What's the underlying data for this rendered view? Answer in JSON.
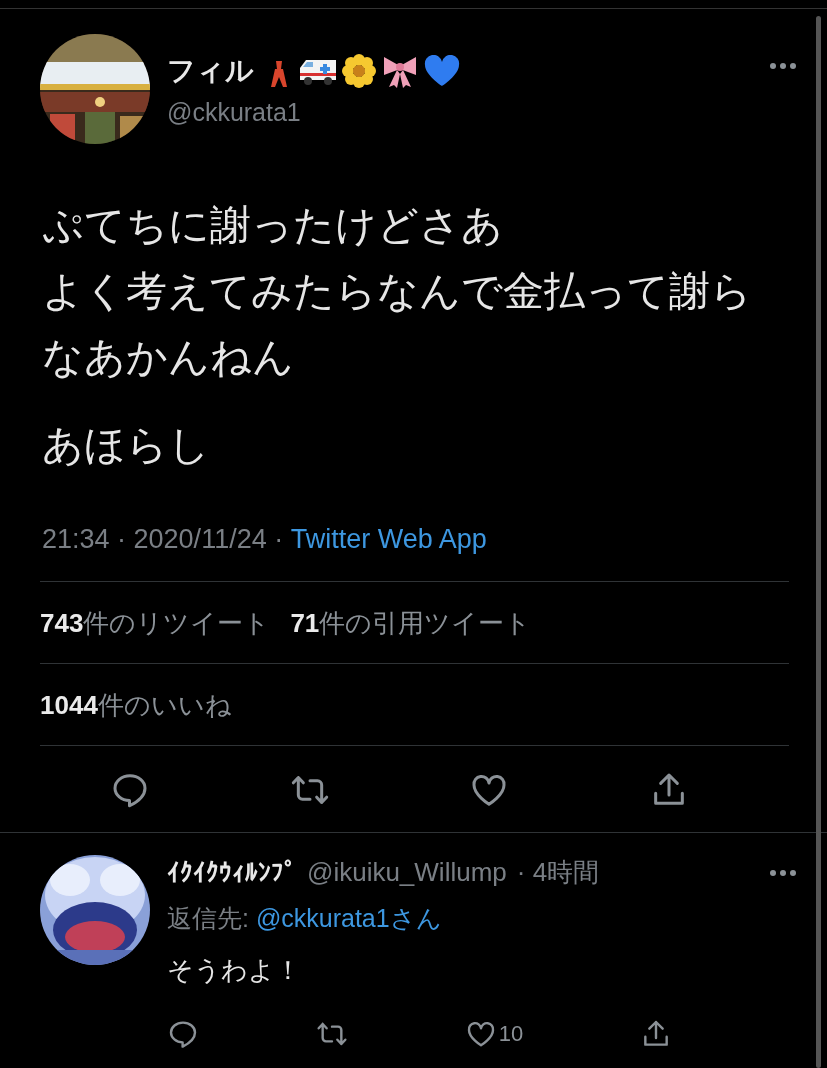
{
  "tweet": {
    "author": {
      "name": "フィル",
      "handle": "@ckkurata1"
    },
    "text": [
      "ぷてちに謝ったけどさあ",
      "よく考えてみたらなんで金払って謝ら",
      "なあかんねん"
    ],
    "text_2": "あほらし",
    "meta": {
      "time": "21:34 · 2020/11/24 · ",
      "source": "Twitter Web App"
    },
    "stats": [
      "**743**件のリツイート",
      "**71**件の引用ツイート"
    ],
    "likes": "**1044**件のいいね"
  },
  "reply": {
    "name": "ｲｸｲｸｳｨﾙﾝﾌﾟ",
    "handle": "@ikuiku_Willump",
    "time": "· 4時間",
    "reply_to_label": "返信先: ",
    "reply_to": "@ckkurata1さん",
    "text": "そうわよ！",
    "like_count": "10"
  }
}
